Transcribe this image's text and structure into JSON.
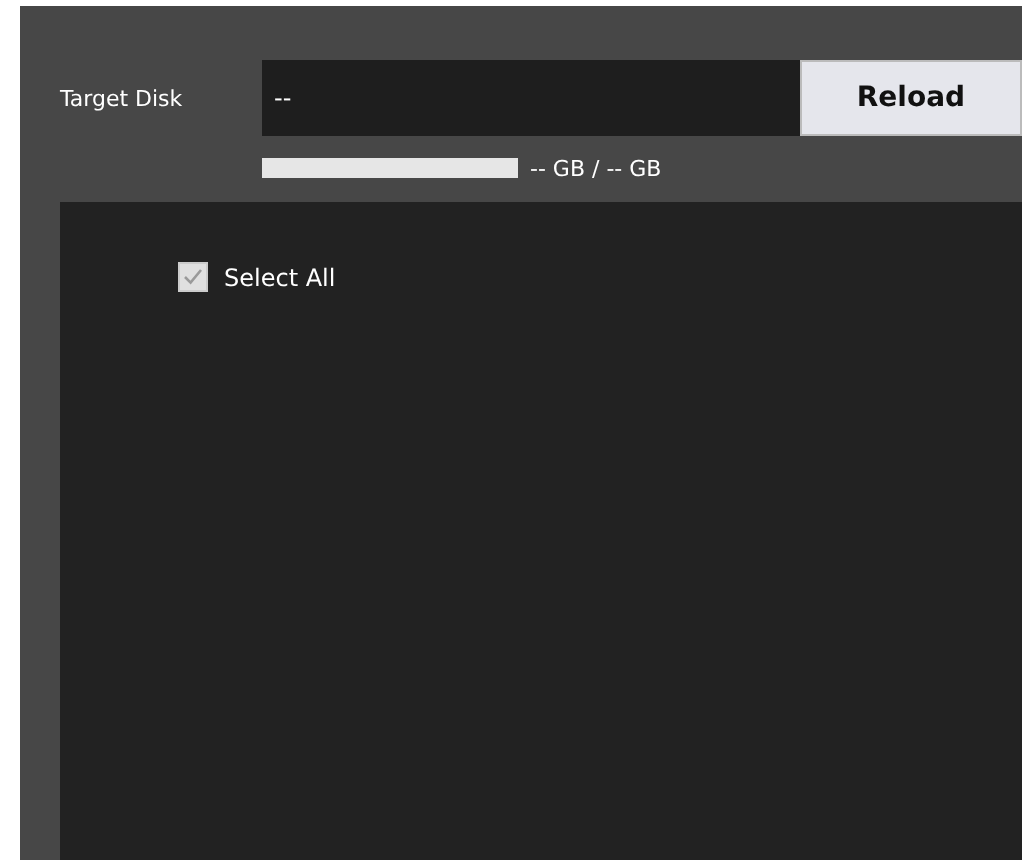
{
  "target_disk": {
    "label": "Target Disk",
    "value": "--",
    "button": "Reload"
  },
  "usage": {
    "level": 0,
    "reading": "-- GB / -- GB"
  },
  "select_all": {
    "label": "Select All",
    "checked": true
  }
}
